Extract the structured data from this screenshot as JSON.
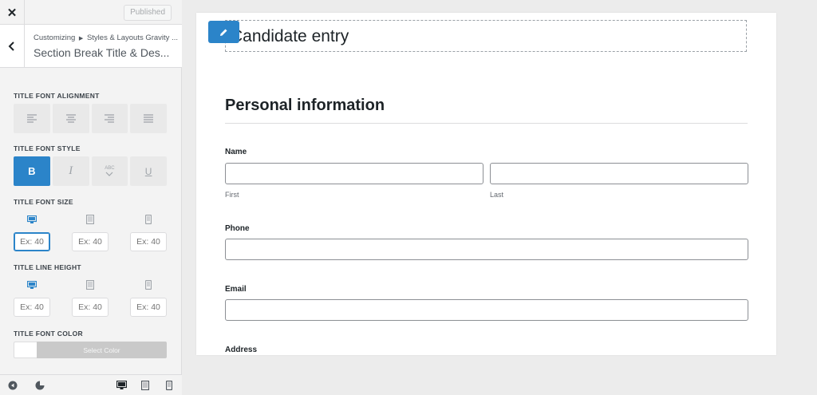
{
  "sidebar": {
    "close_icon": "close-icon",
    "published_label": "Published",
    "breadcrumb_parts": [
      "Customizing",
      "Styles & Layouts Gravity ..."
    ],
    "section_title": "Section Break Title & Des...",
    "controls": {
      "alignment_label": "TITLE FONT ALIGNMENT",
      "alignment_options": [
        "align-left",
        "align-center",
        "align-right",
        "justify"
      ],
      "style_label": "TITLE FONT STYLE",
      "style_bold": "B",
      "style_italic": "I",
      "style_smallcaps": "ABC",
      "style_underline": "U",
      "style_active": "bold",
      "size_label": "TITLE FONT SIZE",
      "size_placeholder": "Ex: 40",
      "line_height_label": "TITLE LINE HEIGHT",
      "line_height_placeholder": "Ex: 40",
      "devices": [
        "desktop",
        "tablet",
        "mobile"
      ],
      "color_label": "TITLE FONT COLOR",
      "select_color_label": "Select Color"
    }
  },
  "preview": {
    "form_title": "Candidate entry",
    "section_heading": "Personal information",
    "fields": {
      "name_label": "Name",
      "first_sublabel": "First",
      "last_sublabel": "Last",
      "phone_label": "Phone",
      "email_label": "Email",
      "address_label": "Address"
    }
  },
  "colors": {
    "accent": "#2b84c9",
    "sidebar_bg": "#f3f3f3",
    "preview_bg": "#ffffff"
  }
}
